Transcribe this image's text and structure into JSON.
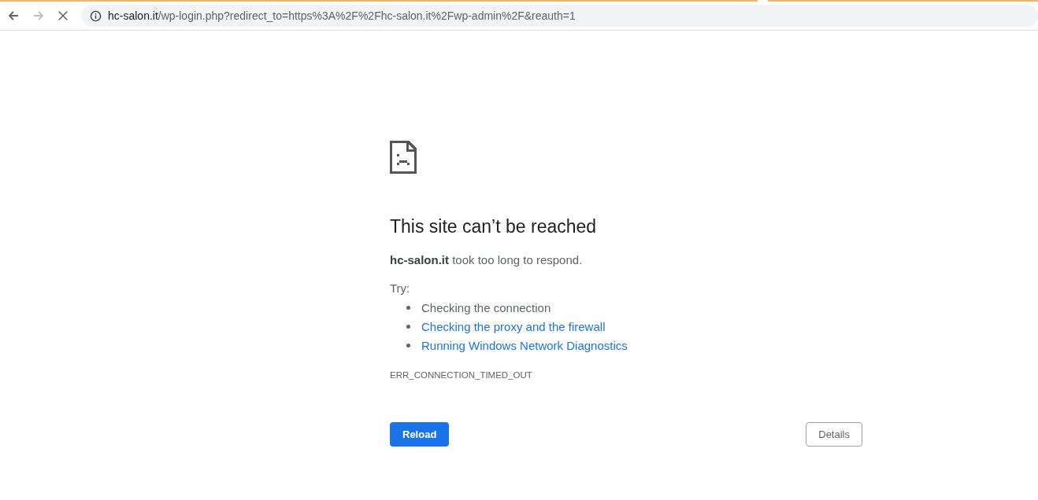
{
  "toolbar": {
    "forward_disabled": true,
    "url_host": "hc-salon.it",
    "url_path": "/wp-login.php?redirect_to=https%3A%2F%2Fhc-salon.it%2Fwp-admin%2F&reauth=1"
  },
  "error": {
    "heading": "This site can’t be reached",
    "summary": "**hc-salon.it** took too long to respond.",
    "try_label": "Try:",
    "suggestions": [
      {
        "text": "Checking the connection",
        "kind": "plain"
      },
      {
        "text": "Checking the proxy and the firewall",
        "kind": "link"
      },
      {
        "text": "Running Windows Network Diagnostics",
        "kind": "link"
      }
    ],
    "code": "ERR_CONNECTION_TIMED_OUT"
  },
  "buttons": {
    "reload": "Reload",
    "details": "Details"
  }
}
